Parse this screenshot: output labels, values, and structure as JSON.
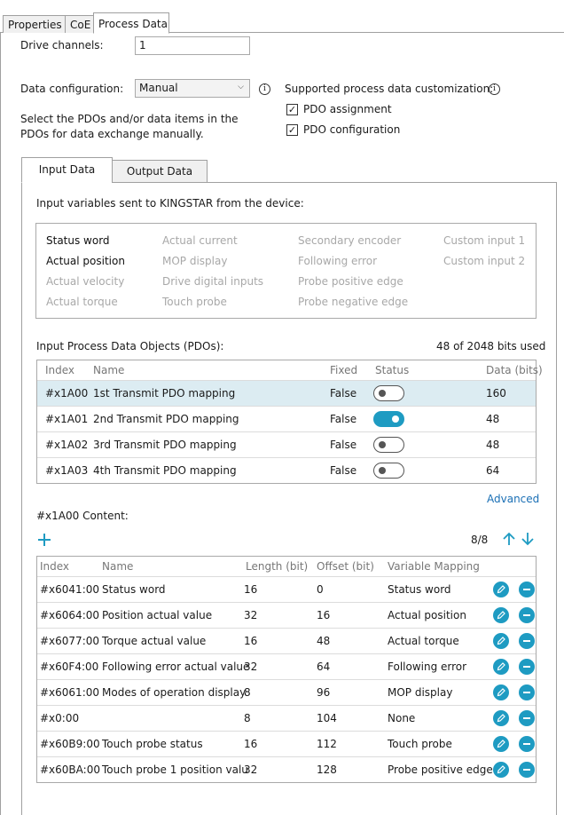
{
  "tabs": [
    "Properties",
    "CoE",
    "Process Data"
  ],
  "drive_channels": {
    "label": "Drive channels:",
    "value": "1"
  },
  "data_configuration": {
    "label": "Data configuration:",
    "value": "Manual"
  },
  "customization": {
    "label": "Supported process data customization:",
    "pdo_assignment": "PDO assignment",
    "pdo_configuration": "PDO configuration"
  },
  "description": [
    "Select the PDOs and/or data items in the",
    "PDOs for data exchange manually."
  ],
  "inner_tabs": [
    "Input Data",
    "Output Data"
  ],
  "input_vars_label": "Input variables sent to KINGSTAR from the device:",
  "variables": {
    "col1": [
      {
        "label": "Status word",
        "on": true
      },
      {
        "label": "Actual position",
        "on": true
      },
      {
        "label": "Actual velocity",
        "on": false
      },
      {
        "label": "Actual torque",
        "on": false
      }
    ],
    "col2": [
      {
        "label": "Actual current",
        "on": false
      },
      {
        "label": "MOP display",
        "on": false
      },
      {
        "label": "Drive digital inputs",
        "on": false
      },
      {
        "label": "Touch probe",
        "on": false
      }
    ],
    "col3": [
      {
        "label": "Secondary encoder",
        "on": false
      },
      {
        "label": "Following error",
        "on": false
      },
      {
        "label": "Probe positive edge",
        "on": false
      },
      {
        "label": "Probe negative edge",
        "on": false
      }
    ],
    "col4": [
      {
        "label": "Custom input 1",
        "on": false
      },
      {
        "label": "Custom input 2",
        "on": false
      }
    ]
  },
  "pdo_section": {
    "label": "Input Process Data Objects (PDOs):",
    "bits_used": "48 of 2048 bits used",
    "headers": [
      "Index",
      "Name",
      "Fixed",
      "Status",
      "Data (bits)"
    ],
    "rows": [
      {
        "index": "#x1A00",
        "name": "1st Transmit PDO mapping",
        "fixed": "False",
        "status": false,
        "bits": "160"
      },
      {
        "index": "#x1A01",
        "name": "2nd Transmit PDO mapping",
        "fixed": "False",
        "status": true,
        "bits": "48"
      },
      {
        "index": "#x1A02",
        "name": "3rd Transmit PDO mapping",
        "fixed": "False",
        "status": false,
        "bits": "48"
      },
      {
        "index": "#x1A03",
        "name": "4th Transmit PDO mapping",
        "fixed": "False",
        "status": false,
        "bits": "64"
      }
    ]
  },
  "advanced_link": "Advanced",
  "content_section": {
    "label": "#x1A00 Content:",
    "add_icon": "plus-icon",
    "count": "8/8",
    "headers": [
      "Index",
      "Name",
      "Length (bit)",
      "Offset (bit)",
      "Variable Mapping"
    ],
    "rows": [
      {
        "index": "#x6041:00",
        "name": "Status word",
        "length": "16",
        "offset": "0",
        "mapping": "Status word"
      },
      {
        "index": "#x6064:00",
        "name": "Position actual value",
        "length": "32",
        "offset": "16",
        "mapping": "Actual position"
      },
      {
        "index": "#x6077:00",
        "name": "Torque actual value",
        "length": "16",
        "offset": "48",
        "mapping": "Actual torque"
      },
      {
        "index": "#x60F4:00",
        "name": "Following error actual value",
        "length": "32",
        "offset": "64",
        "mapping": "Following error"
      },
      {
        "index": "#x6061:00",
        "name": "Modes of operation display",
        "length": "8",
        "offset": "96",
        "mapping": "MOP display"
      },
      {
        "index": "#x0:00",
        "name": "",
        "length": "8",
        "offset": "104",
        "mapping": "None"
      },
      {
        "index": "#x60B9:00",
        "name": "Touch probe status",
        "length": "16",
        "offset": "112",
        "mapping": "Touch probe"
      },
      {
        "index": "#x60BA:00",
        "name": "Touch probe 1 position valu",
        "length": "32",
        "offset": "128",
        "mapping": "Probe positive edge"
      }
    ]
  },
  "colors": {
    "accent": "#1e9bc2",
    "selected_row": "#dcecf2",
    "link": "#1a6fb5"
  }
}
